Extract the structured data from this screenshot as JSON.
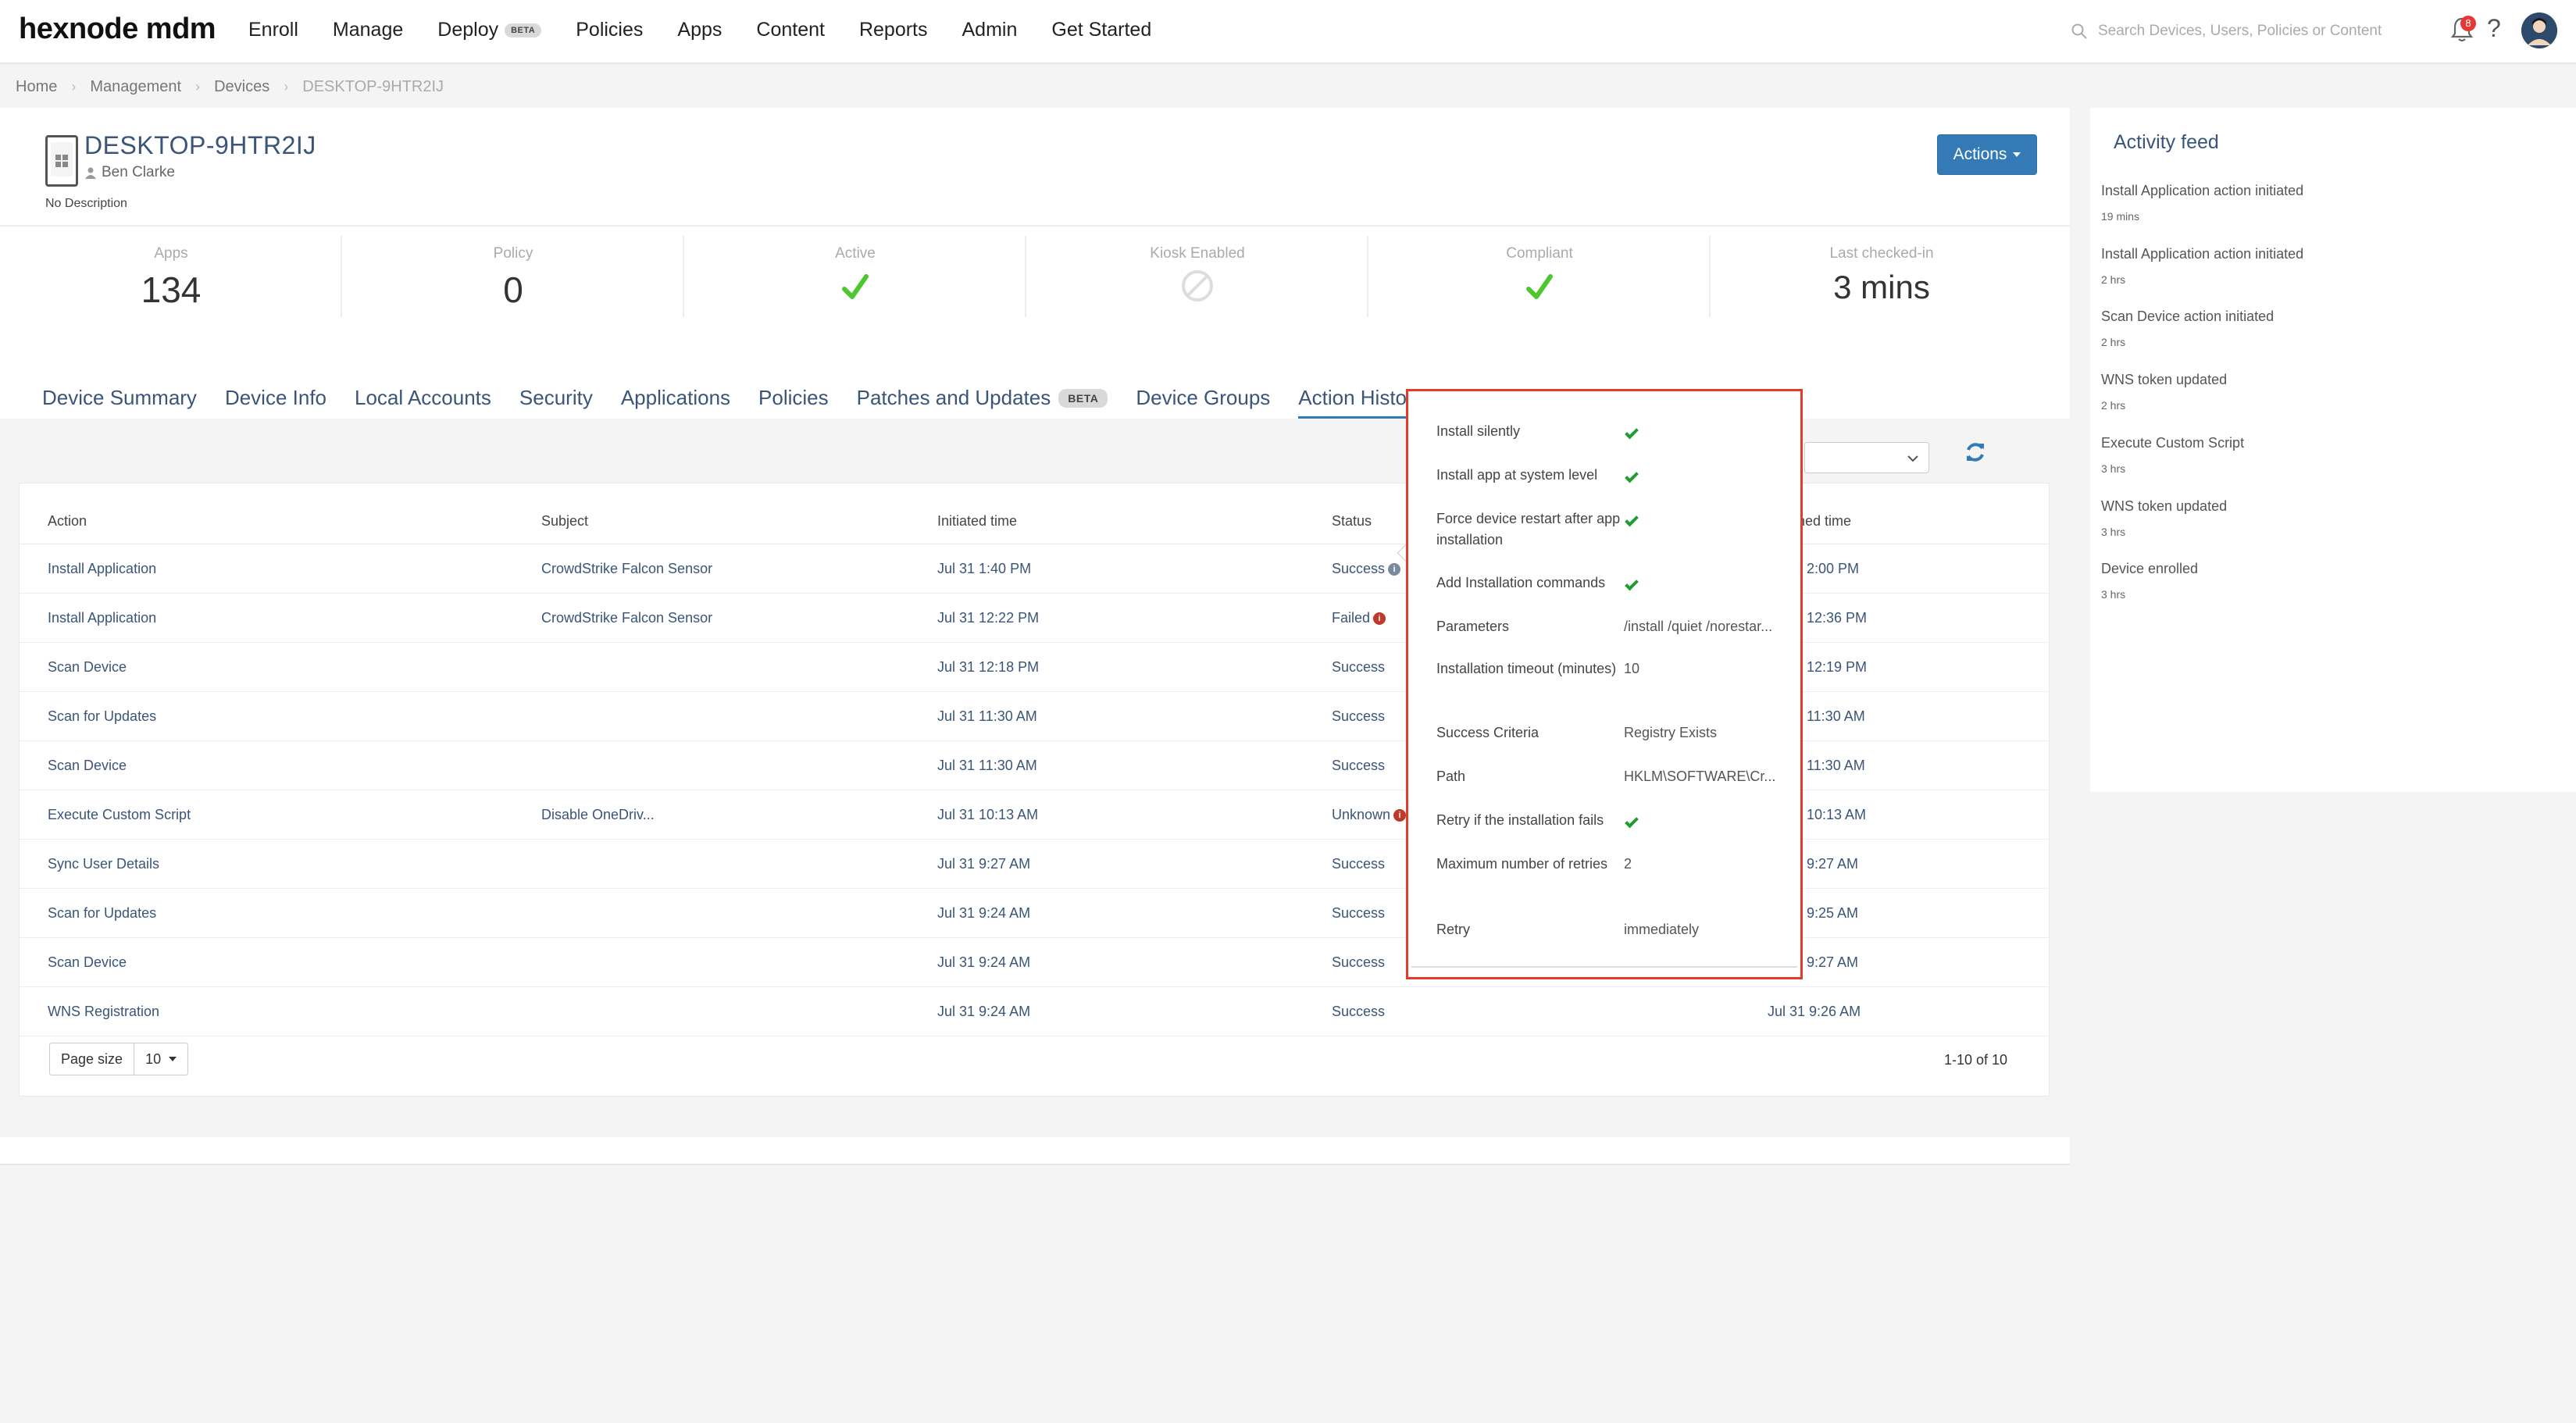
{
  "brand": {
    "logo_text": "hexnode mdm",
    "accent": "#337ab7",
    "highlight": "#e43b2c"
  },
  "nav": {
    "items": [
      {
        "label": "Enroll"
      },
      {
        "label": "Manage"
      },
      {
        "label": "Deploy",
        "badge": "BETA"
      },
      {
        "label": "Policies"
      },
      {
        "label": "Apps"
      },
      {
        "label": "Content"
      },
      {
        "label": "Reports"
      },
      {
        "label": "Admin"
      },
      {
        "label": "Get Started"
      }
    ],
    "search_placeholder": "Search Devices, Users, Policies or Content",
    "notification_count": "8",
    "help_glyph": "?"
  },
  "breadcrumb": {
    "items": [
      "Home",
      "Management",
      "Devices"
    ],
    "current": "DESKTOP-9HTR2IJ"
  },
  "device": {
    "name": "DESKTOP-9HTR2IJ",
    "user": "Ben Clarke",
    "description": "No Description",
    "actions_label": "Actions"
  },
  "stats": {
    "apps": {
      "label": "Apps",
      "value": "134"
    },
    "policy": {
      "label": "Policy",
      "value": "0"
    },
    "active": {
      "label": "Active"
    },
    "kiosk": {
      "label": "Kiosk Enabled"
    },
    "compliant": {
      "label": "Compliant"
    },
    "last_checked": {
      "label": "Last checked-in",
      "value": "3 mins"
    }
  },
  "tabs": {
    "device_summary": "Device Summary",
    "device_info": "Device Info",
    "local_accounts": "Local Accounts",
    "security": "Security",
    "applications": "Applications",
    "policies": "Policies",
    "patches": "Patches and Updates",
    "patches_badge": "BETA",
    "device_groups": "Device Groups",
    "action_history": "Action History"
  },
  "table": {
    "headers": {
      "action": "Action",
      "subject": "Subject",
      "initiated": "Initiated time",
      "status": "Status",
      "finished": "hed time"
    },
    "rows": [
      {
        "action": "Install Application",
        "subject": "CrowdStrike Falcon Sensor",
        "initiated": "Jul 31 1:40 PM",
        "status": "Success",
        "finished": "2:00 PM"
      },
      {
        "action": "Install Application",
        "subject": "CrowdStrike Falcon Sensor",
        "initiated": "Jul 31 12:22 PM",
        "status": "Failed",
        "finished": "12:36 PM"
      },
      {
        "action": "Scan Device",
        "subject": "",
        "initiated": "Jul 31 12:18 PM",
        "status": "Success",
        "finished": "12:19 PM"
      },
      {
        "action": "Scan for Updates",
        "subject": "",
        "initiated": "Jul 31 11:30 AM",
        "status": "Success",
        "finished": "11:30 AM"
      },
      {
        "action": "Scan Device",
        "subject": "",
        "initiated": "Jul 31 11:30 AM",
        "status": "Success",
        "finished": "11:30 AM"
      },
      {
        "action": "Execute Custom Script",
        "subject": "Disable OneDriv...",
        "initiated": "Jul 31 10:13 AM",
        "status": "Unknown",
        "finished": "10:13 AM"
      },
      {
        "action": "Sync User Details",
        "subject": "",
        "initiated": "Jul 31 9:27 AM",
        "status": "Success",
        "finished": "9:27 AM"
      },
      {
        "action": "Scan for Updates",
        "subject": "",
        "initiated": "Jul 31 9:24 AM",
        "status": "Success",
        "finished": "9:25 AM"
      },
      {
        "action": "Scan Device",
        "subject": "",
        "initiated": "Jul 31 9:24 AM",
        "status": "Success",
        "finished": "9:27 AM"
      },
      {
        "action": "WNS Registration",
        "subject": "",
        "initiated": "Jul 31 9:24 AM",
        "status": "Success",
        "finished": "Jul 31 9:26 AM"
      }
    ],
    "page_size_label": "Page size",
    "page_size_value": "10",
    "pagination": "1-10 of 10"
  },
  "popover": {
    "install_silently": "Install silently",
    "install_system": "Install app at system level",
    "force_restart": "Force device restart after app installation",
    "add_commands": "Add Installation commands",
    "parameters_label": "Parameters",
    "parameters_value": "/install /quiet /norestar...",
    "timeout_label": "Installation timeout (minutes)",
    "timeout_value": "10",
    "criteria_label": "Success Criteria",
    "criteria_value": "Registry Exists",
    "path_label": "Path",
    "path_value": "HKLM\\SOFTWARE\\Cr...",
    "retry_fail_label": "Retry if the installation fails",
    "max_retries_label": "Maximum number of retries",
    "max_retries_value": "2",
    "retry_label": "Retry",
    "retry_value": "immediately"
  },
  "activity": {
    "title": "Activity feed",
    "items": [
      {
        "action": "Install Application action initiated",
        "time": "19 mins"
      },
      {
        "action": "Install Application action initiated",
        "time": "2 hrs"
      },
      {
        "action": "Scan Device action initiated",
        "time": "2 hrs"
      },
      {
        "action": "WNS token updated",
        "time": "2 hrs"
      },
      {
        "action": "Execute Custom Script",
        "time": "3 hrs"
      },
      {
        "action": "WNS token updated",
        "time": "3 hrs"
      },
      {
        "action": "Device enrolled",
        "time": "3 hrs"
      }
    ]
  }
}
